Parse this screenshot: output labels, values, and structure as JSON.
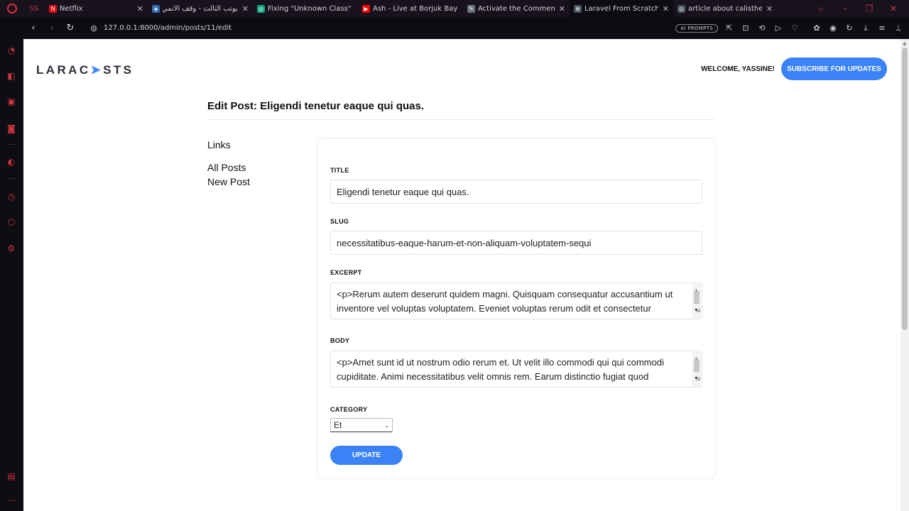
{
  "browser": {
    "tabs": [
      {
        "label": "Netflix",
        "fav_color": "#e50914",
        "fav_glyph": "N"
      },
      {
        "label": "ﺑﻮﺗﺐ اﻟﺜﺎﻟﺚ - وقف الأنمي",
        "fav_color": "#2b6cb0",
        "fav_glyph": "◈"
      },
      {
        "label": "Fixing \"Unknown Class\" E",
        "fav_color": "#10a37f",
        "fav_glyph": "◎"
      },
      {
        "label": "Ash - Live at Borjuk Bay",
        "fav_color": "#ff0000",
        "fav_glyph": "▶"
      },
      {
        "label": "Activate the Comment Fo",
        "fav_color": "#6b7280",
        "fav_glyph": "✎"
      },
      {
        "label": "Laravel From Scratch Blo",
        "fav_color": "#4b5563",
        "fav_glyph": "⊕"
      },
      {
        "label": "article about calisthenics",
        "fav_color": "#4b5563",
        "fav_glyph": "◎"
      }
    ],
    "url": "127.0.0.1:8000/admin/posts/11/edit",
    "ai_prompts_label": "AI PROMPTS"
  },
  "header": {
    "logo_text_a": "LARAC",
    "logo_text_b": "STS",
    "welcome": "WELCOME, YASSINE!",
    "subscribe_label": "SUBSCRIBE FOR UPDATES"
  },
  "page": {
    "title": "Edit Post: Eligendi tenetur eaque qui quas."
  },
  "links": {
    "heading": "Links",
    "items": [
      "All Posts",
      "New Post"
    ]
  },
  "form": {
    "title_label": "TITLE",
    "title_value": "Eligendi tenetur eaque qui quas.",
    "slug_label": "SLUG",
    "slug_value": "necessitatibus-eaque-harum-et-non-aliquam-voluptatem-sequi",
    "excerpt_label": "EXCERPT",
    "excerpt_value": "<p>Rerum autem deserunt quidem magni. Quisquam consequatur accusantium ut inventore vel voluptas voluptatem. Eveniet voluptas rerum odit et consectetur",
    "body_label": "BODY",
    "body_value": "<p>Amet sunt id ut nostrum odio rerum et. Ut velit illo commodi qui qui commodi cupiditate. Animi necessitatibus velit omnis rem. Earum distinctio fugiat quod",
    "category_label": "CATEGORY",
    "category_value": "Et",
    "update_label": "UPDATE"
  },
  "colors": {
    "accent": "#3b82f6",
    "opera_red": "#e0303a"
  }
}
